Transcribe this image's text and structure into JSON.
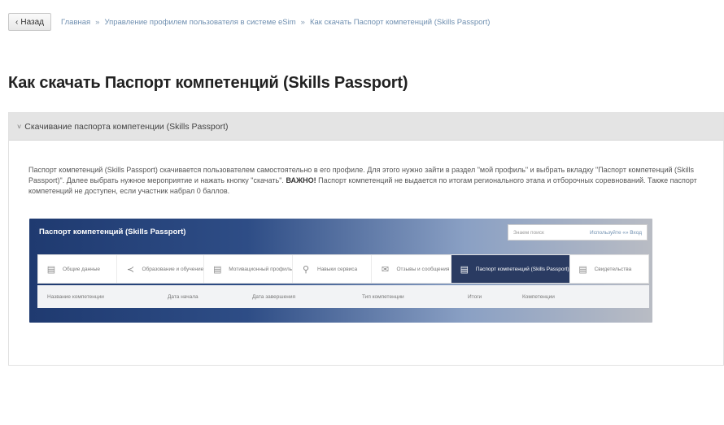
{
  "nav": {
    "back_label": "Назад",
    "back_arrow": "‹",
    "breadcrumbs": [
      "Главная",
      "Управление профилем пользователя в системе eSim",
      "Как скачать Паспорт компетенций (Skills Passport)"
    ],
    "separator": "»"
  },
  "page": {
    "title": "Как скачать Паспорт компетенций (Skills Passport)"
  },
  "section": {
    "caret": "˅",
    "title": "Скачивание паспорта компетенции (Skills Passport)",
    "text_1": "Паспорт компетенций (Skills Passport) скачивается пользователем самостоятельно в его профиле. Для этого нужно зайти в раздел \"мой профиль\" и выбрать вкладку \"Паспорт компетенций (Skills Passport)\". Далее выбрать нужное мероприятие и нажать кнопку \"скачать\".",
    "important": "ВАЖНО!",
    "text_2": "Паспорт компетенций не выдается по итогам регионального этапа и отборочных соревнований. Также паспорт компетенций не доступен, если участник набрал 0 баллов."
  },
  "screenshot": {
    "title": "Паспорт компетенций (Skills Passport)",
    "search_placeholder": "Знаем поиск",
    "search_hint": "Используйте «» Вход",
    "tabs": [
      {
        "label": "Общие данные",
        "icon": "document-icon"
      },
      {
        "label": "Образование и обучение",
        "icon": "share-icon"
      },
      {
        "label": "Мотивационный профиль",
        "icon": "document-icon"
      },
      {
        "label": "Навыки сервиса",
        "icon": "search-icon"
      },
      {
        "label": "Отзывы и сообщения",
        "icon": "mail-icon"
      },
      {
        "label": "Паспорт компетенций (Skills Passport)",
        "icon": "document-icon"
      },
      {
        "label": "Свидетельства",
        "icon": "document-icon"
      }
    ],
    "columns": [
      "Название компетенции",
      "Дата начала",
      "Дата завершения",
      "Тип компетенции",
      "Итоги",
      "Компетенции"
    ]
  },
  "colors": {
    "active_tab": "#2a3b62",
    "banner_start": "#1f3a70",
    "link": "#6f8fb0"
  }
}
